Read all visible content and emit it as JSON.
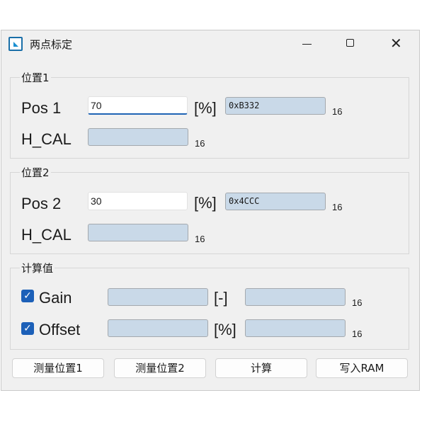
{
  "window": {
    "title": "两点标定"
  },
  "group1": {
    "title": "位置1",
    "pos_label": "Pos 1",
    "pos_value": "70",
    "pos_unit": "[%]",
    "pos_hex": "0xB332",
    "pos_hex_suffix": "16",
    "hcal_label": "H_CAL",
    "hcal_value": "",
    "hcal_suffix": "16"
  },
  "group2": {
    "title": "位置2",
    "pos_label": "Pos 2",
    "pos_value": "30",
    "pos_unit": "[%]",
    "pos_hex": "0x4CCC",
    "pos_hex_suffix": "16",
    "hcal_label": "H_CAL",
    "hcal_value": "",
    "hcal_suffix": "16"
  },
  "calc": {
    "title": "计算值",
    "gain_label": "Gain",
    "gain_checked": true,
    "gain_value": "",
    "gain_unit": "[-]",
    "gain_hex": "",
    "gain_suffix": "16",
    "offset_label": "Offset",
    "offset_checked": true,
    "offset_value": "",
    "offset_unit": "[%]",
    "offset_hex": "",
    "offset_suffix": "16"
  },
  "buttons": {
    "measure1": "测量位置1",
    "measure2": "测量位置2",
    "compute": "计算",
    "write_ram": "写入RAM"
  },
  "icons": {
    "app": "app-icon",
    "minimize": "minimize-icon",
    "maximize": "maximize-icon",
    "close": "close-icon",
    "check": "checkmark-icon"
  },
  "colors": {
    "accent": "#1c60b8",
    "readonly_field": "#c9d9e8",
    "window_bg": "#f0f0f0"
  }
}
